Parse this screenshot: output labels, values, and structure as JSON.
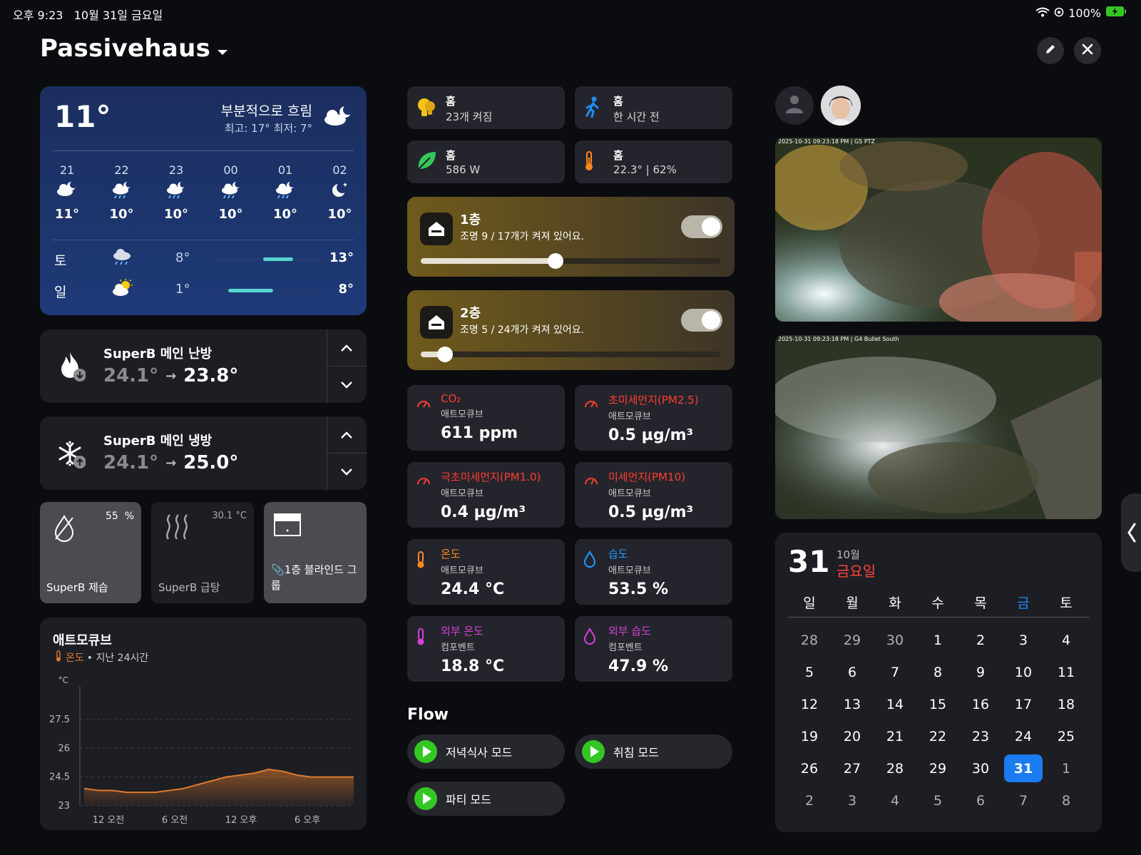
{
  "status": {
    "time": "오후 9:23",
    "date": "10월 31일 금요일",
    "battery": "100%"
  },
  "header": {
    "title": "Passivehaus",
    "edit_icon": "pencil-icon",
    "close_icon": "close-icon"
  },
  "weather": {
    "temp": "11°",
    "condition": "부분적으로 흐림",
    "hilo": "최고: 17° 최저: 7°",
    "hourly": [
      {
        "hour": "21",
        "icon": "cloud-moon",
        "temp": "11°"
      },
      {
        "hour": "22",
        "icon": "rain-moon",
        "temp": "10°"
      },
      {
        "hour": "23",
        "icon": "rain-moon",
        "temp": "10°"
      },
      {
        "hour": "00",
        "icon": "rain-moon",
        "temp": "10°"
      },
      {
        "hour": "01",
        "icon": "rain-moon",
        "temp": "10°"
      },
      {
        "hour": "02",
        "icon": "moon-stars",
        "temp": "10°"
      }
    ],
    "daily": [
      {
        "day": "토",
        "icon": "rain",
        "low": "8°",
        "high": "13°"
      },
      {
        "day": "일",
        "icon": "sun-cloud",
        "low": "1°",
        "high": "8°"
      }
    ]
  },
  "climate": [
    {
      "name": "SuperB 메인 난방",
      "current": "24.1°",
      "target": "23.8°",
      "icon": "flame-icon"
    },
    {
      "name": "SuperB 메인 냉방",
      "current": "24.1°",
      "target": "25.0°",
      "icon": "snowflake-icon"
    }
  ],
  "small_tiles": [
    {
      "label": "SuperB 제습",
      "value": "55",
      "unit": "%"
    },
    {
      "label": "SuperB 급탕",
      "value": "30.1 °C"
    },
    {
      "label": "1층 블라인드 그룹"
    }
  ],
  "chart_card": {
    "title": "애트모큐브",
    "series_label": "온도",
    "period": "• 지난 24시간"
  },
  "chart_data": {
    "type": "area",
    "ylabel": "°C",
    "yticks": [
      "23",
      "24.5",
      "26",
      "27.5"
    ],
    "ylim": [
      23,
      28.5
    ],
    "xticks": [
      "12 오전",
      "6 오전",
      "12 오후",
      "6 오후"
    ],
    "series": [
      {
        "values": [
          23.9,
          23.8,
          23.8,
          23.7,
          23.7,
          23.7,
          23.8,
          23.9,
          24.1,
          24.3,
          24.5,
          24.6,
          24.7,
          24.9,
          24.8,
          24.6,
          24.5,
          24.5,
          24.5,
          24.5
        ]
      }
    ],
    "color": "#e07a2c"
  },
  "status_tiles": [
    {
      "title": "홈",
      "sub": "23개 켜짐",
      "icon": "bulb-icon"
    },
    {
      "title": "홈",
      "sub": "한 시간 전",
      "icon": "motion-icon"
    },
    {
      "title": "홈",
      "sub": "586 W",
      "icon": "leaf-icon"
    },
    {
      "title": "홈",
      "sub": "22.3° | 62%",
      "icon": "thermometer-icon"
    }
  ],
  "floors": [
    {
      "name": "1층",
      "desc": "조명 9 / 17개가 켜져 있어요.",
      "level": 0.45
    },
    {
      "name": "2층",
      "desc": "조명 5 / 24개가 켜져 있어요.",
      "level": 0.08
    }
  ],
  "sensors": [
    {
      "name": "CO₂",
      "source": "애트모큐브",
      "value": "611 ppm",
      "color": "#ff3b30"
    },
    {
      "name": "초미세먼지(PM2.5)",
      "source": "애트모큐브",
      "value": "0.5 µg/m³",
      "color": "#ff3b30"
    },
    {
      "name": "극초미세먼지(PM1.0)",
      "source": "애트모큐브",
      "value": "0.4 µg/m³",
      "color": "#ff3b30"
    },
    {
      "name": "미세먼지(PM10)",
      "source": "애트모큐브",
      "value": "0.5 µg/m³",
      "color": "#ff3b30"
    },
    {
      "name": "온도",
      "source": "애트모큐브",
      "value": "24.4 °C",
      "color": "#ff8a1e"
    },
    {
      "name": "습도",
      "source": "애트모큐브",
      "value": "53.5 %",
      "color": "#1e9bff"
    },
    {
      "name": "외부 온도",
      "source": "컴포벤트",
      "value": "18.8 °C",
      "color": "#d63fd6"
    },
    {
      "name": "외부 습도",
      "source": "컴포벤트",
      "value": "47.9 %",
      "color": "#d63fd6"
    }
  ],
  "flow": {
    "title": "Flow",
    "buttons": [
      "저녁식사 모드",
      "취침 모드",
      "파티 모드"
    ]
  },
  "cameras": [
    {
      "label": "2025-10-31 09:23:18 PM | G5 PTZ"
    },
    {
      "label": "2025-10-31 09:23:18 PM | G4 Bullet South"
    }
  ],
  "calendar": {
    "day": "31",
    "month": "10월",
    "weekday": "금요일",
    "headers": [
      "일",
      "월",
      "화",
      "수",
      "목",
      "금",
      "토"
    ],
    "weeks": [
      [
        "28",
        "29",
        "30",
        "1",
        "2",
        "3",
        "4"
      ],
      [
        "5",
        "6",
        "7",
        "8",
        "9",
        "10",
        "11"
      ],
      [
        "12",
        "13",
        "14",
        "15",
        "16",
        "17",
        "18"
      ],
      [
        "19",
        "20",
        "21",
        "22",
        "23",
        "24",
        "25"
      ],
      [
        "26",
        "27",
        "28",
        "29",
        "30",
        "31",
        "1"
      ],
      [
        "2",
        "3",
        "4",
        "5",
        "6",
        "7",
        "8"
      ]
    ]
  }
}
